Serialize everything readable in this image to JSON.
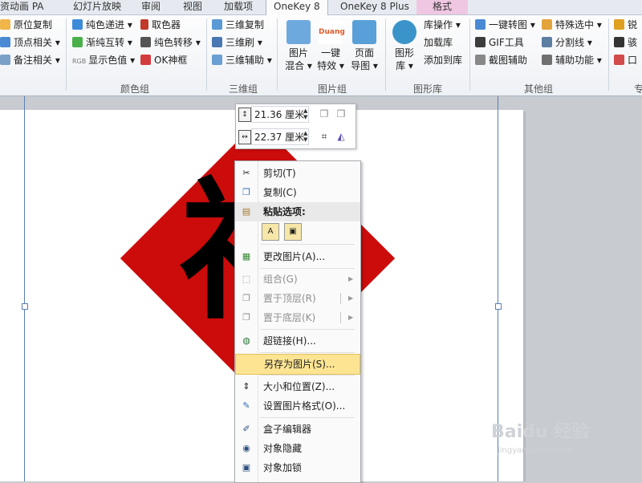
{
  "tabs": [
    "资动画 PA",
    "幻灯片放映",
    "审阅",
    "视图",
    "加载项",
    "OneKey 8",
    "OneKey 8 Plus",
    "格式"
  ],
  "ribbon": {
    "col1": [
      "原位复制",
      "顶点相关",
      "备注相关"
    ],
    "color": [
      "纯色递进",
      "渐纯互转",
      "显示色值",
      "取色器",
      "纯色转移",
      "OK神框"
    ],
    "color_label": "颜色组",
    "rgb_tag": "RGB",
    "three_d": [
      "三维复制",
      "三维刷",
      "三维辅助"
    ],
    "three_d_label": "三维组",
    "image": {
      "mix_1": "图片",
      "mix_2": "混合",
      "effect_1": "一键",
      "effect_2": "特效",
      "export_1": "页面",
      "export_2": "导图",
      "duang": "Duang",
      "label": "图片组"
    },
    "lib": {
      "big_1": "图形",
      "big_2": "库",
      "items": [
        "库操作",
        "加载库",
        "添加到库"
      ],
      "label": "图形库"
    },
    "other": {
      "items": [
        "一键转图",
        "GIF工具",
        "截图辅助",
        "特殊选中",
        "分割线",
        "辅助功能"
      ],
      "label": "其他组"
    },
    "edge": [
      "锐",
      "骇",
      "口"
    ],
    "edge_label": "专"
  },
  "size_toolbar": {
    "height": "21.36 厘米",
    "width": "22.37 厘米"
  },
  "slide": {
    "glyph": "福",
    "diamond_color": "#cc0b0b"
  },
  "context_menu": {
    "items": [
      {
        "label": "剪切(T)",
        "icon": "scissors-icon",
        "state": "normal"
      },
      {
        "label": "复制(C)",
        "icon": "copy-icon",
        "state": "normal"
      },
      {
        "label": "粘贴选项:",
        "icon": "paste-icon",
        "state": "header"
      },
      {
        "label": "更改图片(A)...",
        "icon": "change-picture-icon",
        "state": "normal"
      },
      {
        "label": "组合(G)",
        "icon": "group-icon",
        "state": "disabled"
      },
      {
        "label": "置于顶层(R)",
        "icon": "bring-to-front-icon",
        "state": "disabled"
      },
      {
        "label": "置于底层(K)",
        "icon": "send-to-back-icon",
        "state": "disabled"
      },
      {
        "label": "超链接(H)...",
        "icon": "hyperlink-icon",
        "state": "normal"
      },
      {
        "label": "另存为图片(S)...",
        "icon": "save-as-picture-icon",
        "state": "highlighted"
      },
      {
        "label": "大小和位置(Z)...",
        "icon": "size-position-icon",
        "state": "normal"
      },
      {
        "label": "设置图片格式(O)...",
        "icon": "format-picture-icon",
        "state": "normal"
      },
      {
        "label": "盒子编辑器",
        "icon": "box-editor-icon",
        "state": "normal"
      },
      {
        "label": "对象隐藏",
        "icon": "eye-icon",
        "state": "normal"
      },
      {
        "label": "对象加锁",
        "icon": "lock-icon",
        "state": "normal"
      }
    ]
  },
  "watermark": {
    "brand": "Baidu 经验",
    "url": "jingyan.baidu.com"
  }
}
